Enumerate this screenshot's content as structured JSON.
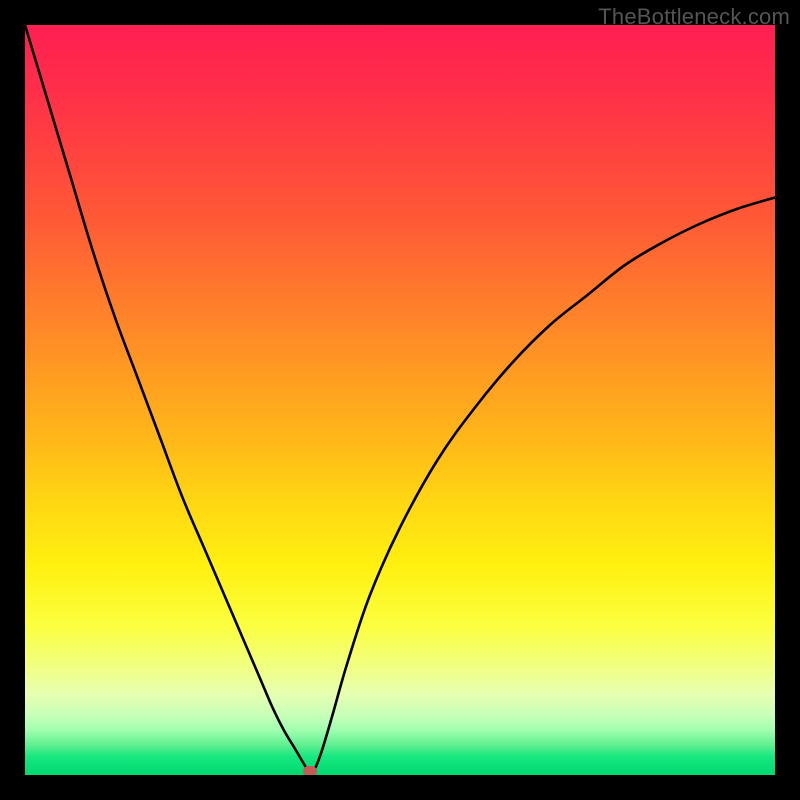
{
  "watermark": "TheBottleneck.com",
  "chart_data": {
    "type": "line",
    "title": "",
    "xlabel": "",
    "ylabel": "",
    "xlim": [
      0,
      100
    ],
    "ylim": [
      0,
      100
    ],
    "grid": false,
    "series": [
      {
        "name": "curve",
        "x": [
          0,
          3,
          6,
          9,
          12,
          15,
          18,
          21,
          24,
          27,
          30,
          31.5,
          33,
          34.5,
          36,
          37,
          37.8,
          38.5,
          39.5,
          41,
          43,
          46,
          50,
          55,
          60,
          65,
          70,
          75,
          80,
          85,
          90,
          95,
          100
        ],
        "values": [
          100,
          90,
          80,
          70,
          61,
          53,
          45,
          37,
          30,
          23,
          16,
          12.5,
          9,
          6,
          3.5,
          1.8,
          0.6,
          0.6,
          3,
          8,
          15,
          24,
          33,
          42,
          49,
          55,
          60,
          64,
          68,
          71,
          73.5,
          75.5,
          77
        ]
      }
    ],
    "marker": {
      "x": 38,
      "y": 0,
      "color": "#c65a54"
    },
    "background_gradient": {
      "top": "#ff1f52",
      "bottom": "#00d870"
    }
  }
}
